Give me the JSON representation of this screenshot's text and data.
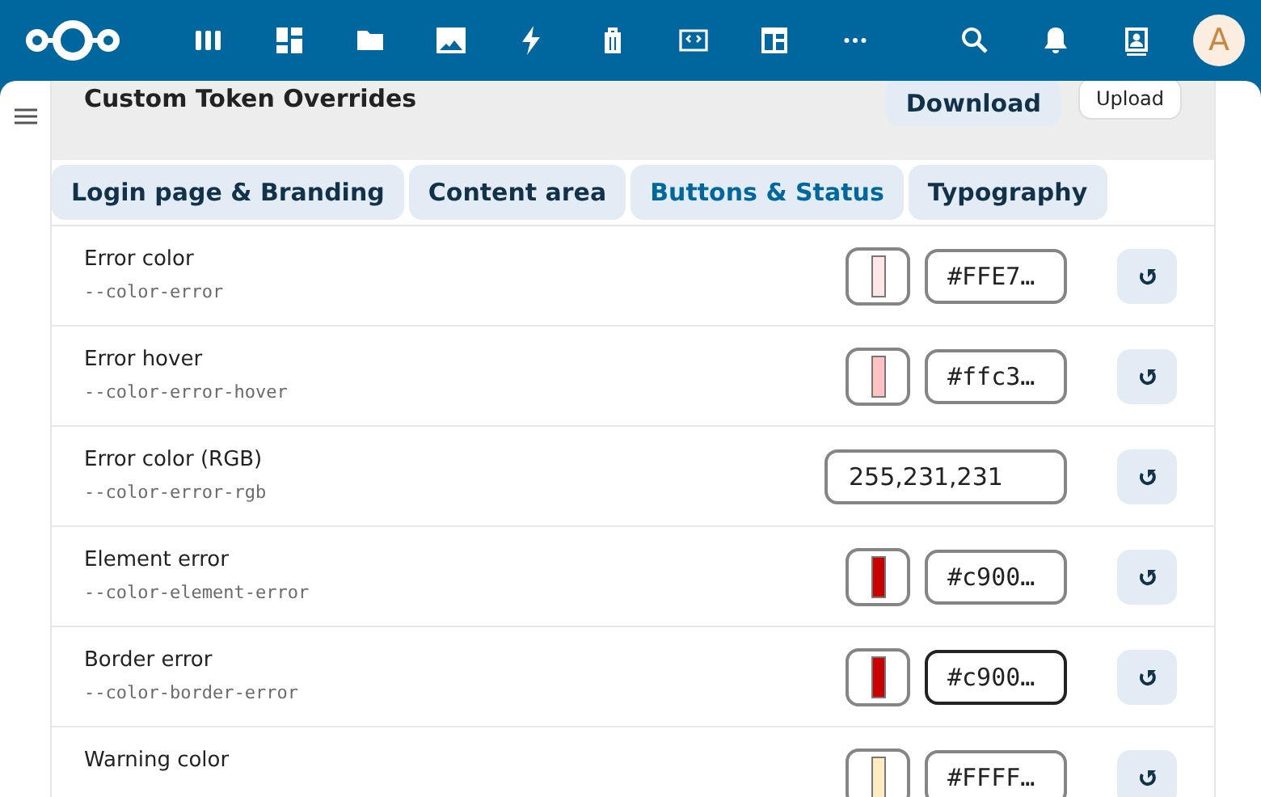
{
  "header": {
    "apps": [
      {
        "kind": "grid-bars"
      },
      {
        "kind": "dashboard"
      },
      {
        "kind": "folder"
      },
      {
        "kind": "image"
      },
      {
        "kind": "bolt"
      },
      {
        "kind": "bag"
      },
      {
        "kind": "code"
      },
      {
        "kind": "table"
      },
      {
        "kind": "more"
      }
    ],
    "avatar": {
      "initial": "A"
    }
  },
  "panel": {
    "title": "Custom Token Overrides",
    "buttons": [
      {
        "label": "Download",
        "kind": "primary"
      },
      {
        "label": "Upload",
        "kind": "secondary"
      }
    ],
    "tabs": [
      {
        "label": "Login page & Branding",
        "selected": false
      },
      {
        "label": "Content area",
        "selected": false
      },
      {
        "label": "Buttons & Status",
        "selected": true
      },
      {
        "label": "Typography",
        "selected": false
      }
    ],
    "rows": [
      {
        "label": "Error color",
        "token": "--color-error",
        "kind": "color",
        "color": "#ffe7e7",
        "value": "#FFE7…",
        "focused": false
      },
      {
        "label": "Error hover",
        "token": "--color-error-hover",
        "kind": "color",
        "color": "#ffc3c3",
        "value": "#ffc3…",
        "focused": false
      },
      {
        "label": "Error color (RGB)",
        "token": "--color-error-rgb",
        "kind": "text",
        "value": "255,231,231",
        "focused": false
      },
      {
        "label": "Element error",
        "token": "--color-element-error",
        "kind": "color",
        "color": "#c90000",
        "value": "#c900…",
        "focused": false
      },
      {
        "label": "Border error",
        "token": "--color-border-error",
        "kind": "color",
        "color": "#c90000",
        "value": "#c900…",
        "focused": true
      },
      {
        "label": "Warning color",
        "kind": "color",
        "color": "#ffecc0",
        "value": "#FFFF…",
        "focused": false
      }
    ]
  }
}
